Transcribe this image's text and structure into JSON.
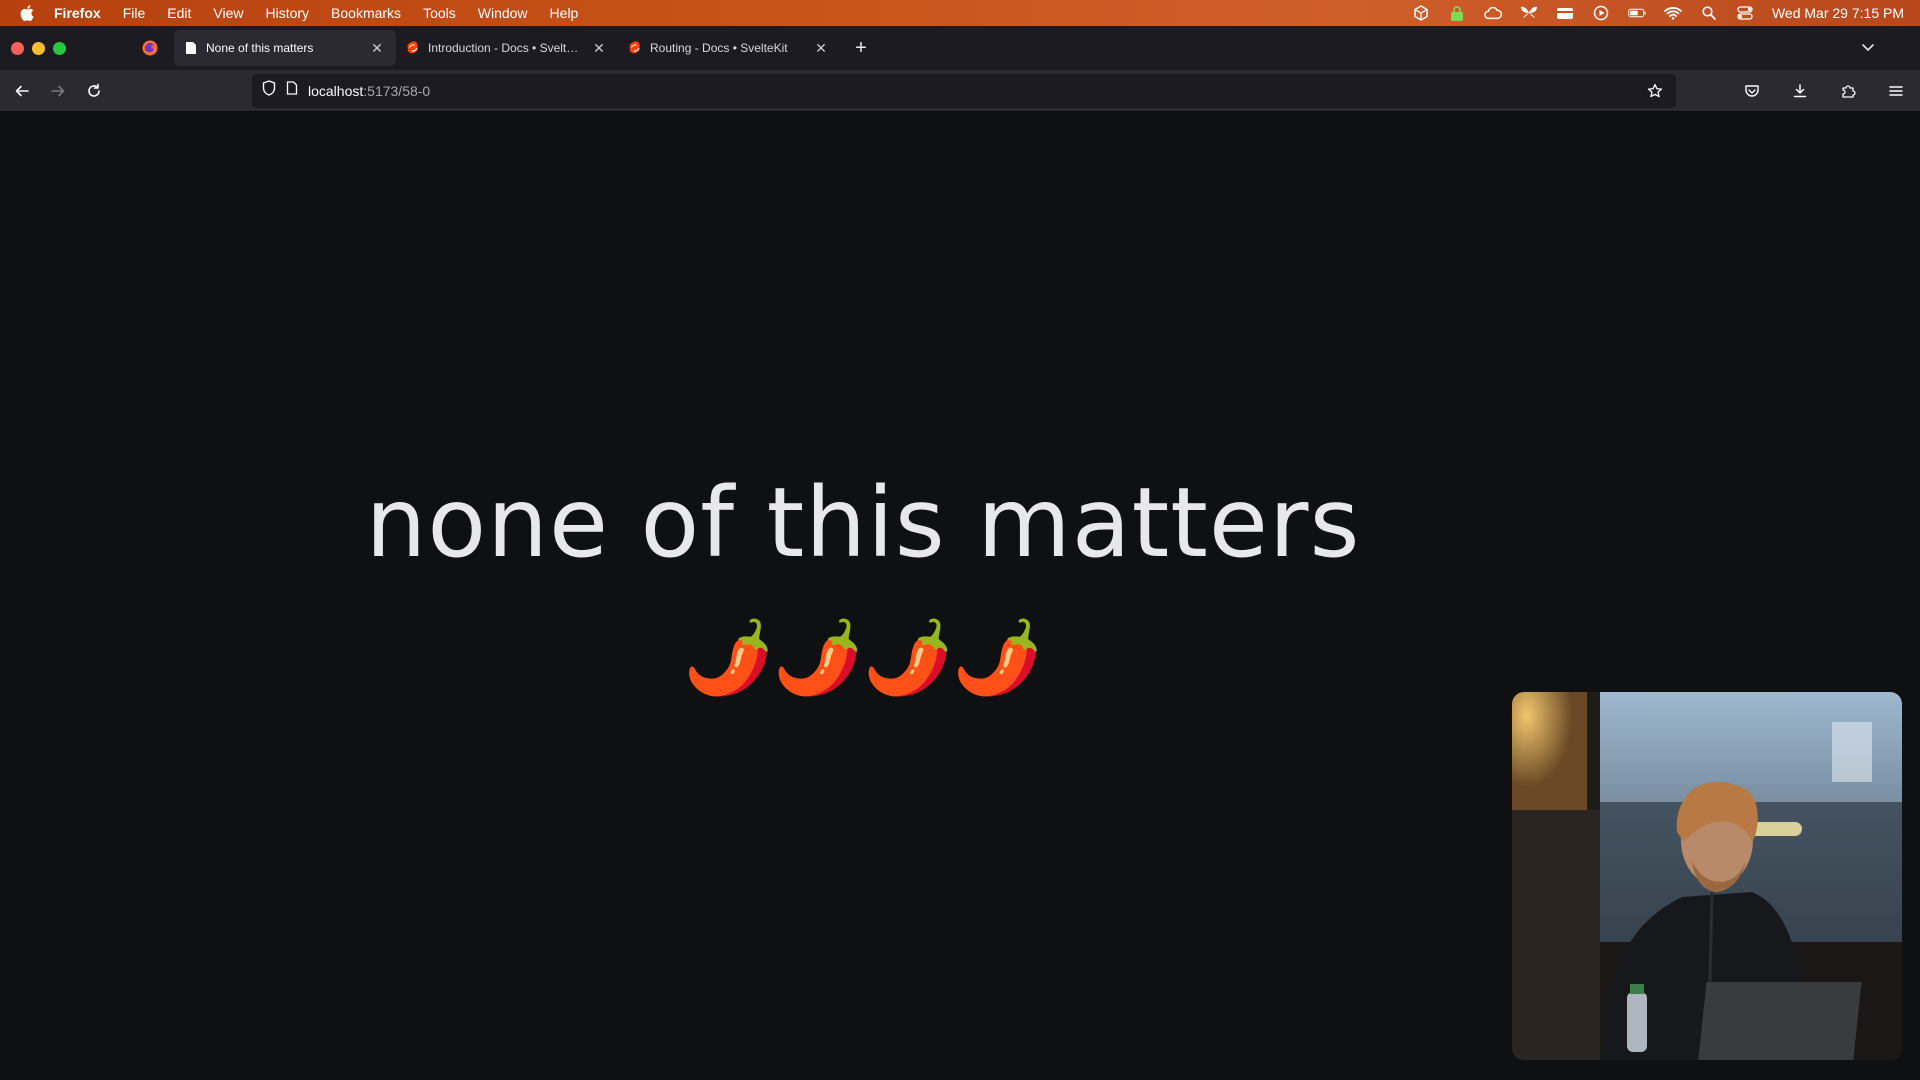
{
  "menubar": {
    "app_name": "Firefox",
    "items": [
      "File",
      "Edit",
      "View",
      "History",
      "Bookmarks",
      "Tools",
      "Window",
      "Help"
    ],
    "clock": "Wed Mar 29  7:15 PM"
  },
  "tabs": [
    {
      "title": "None of this matters",
      "active": true
    },
    {
      "title": "Introduction - Docs • SvelteKit",
      "active": false
    },
    {
      "title": "Routing - Docs • SvelteKit",
      "active": false
    }
  ],
  "urlbar": {
    "host": "localhost",
    "path": ":5173/58-0"
  },
  "page": {
    "headline": "none of this matters",
    "emoji": "🌶️🌶️🌶️🌶️"
  },
  "colors": {
    "menubar": "#c8531a",
    "tabstrip": "#1c1b22",
    "toolbar": "#2b2a33",
    "page_bg": "#0f1011",
    "svelte": "#ff3e00"
  }
}
